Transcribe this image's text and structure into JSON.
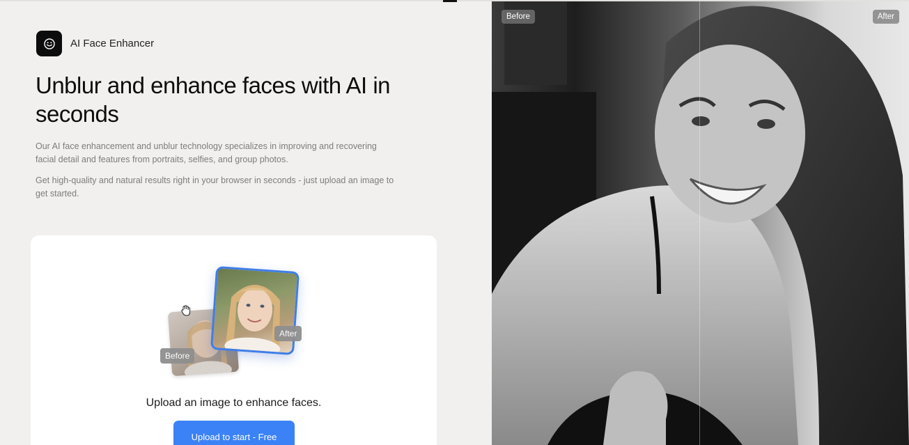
{
  "brand": {
    "name": "AI Face Enhancer",
    "icon": "smiley-face-icon"
  },
  "hero": {
    "headline": "Unblur and enhance faces with AI in seconds",
    "paragraph1": "Our AI face enhancement and unblur technology specializes in improving and recovering facial detail and features from portraits, selfies, and group photos.",
    "paragraph2": "Get high-quality and natural results right in your browser in seconds - just upload an image to get started."
  },
  "upload": {
    "illustration": {
      "before_label": "Before",
      "after_label": "After"
    },
    "prompt": "Upload an image to enhance faces.",
    "button_label": "Upload to start - Free"
  },
  "comparison": {
    "before_label": "Before",
    "after_label": "After"
  },
  "colors": {
    "accent": "#3b82f6",
    "page_bg": "#f1f0ee",
    "card_bg": "#ffffff"
  }
}
